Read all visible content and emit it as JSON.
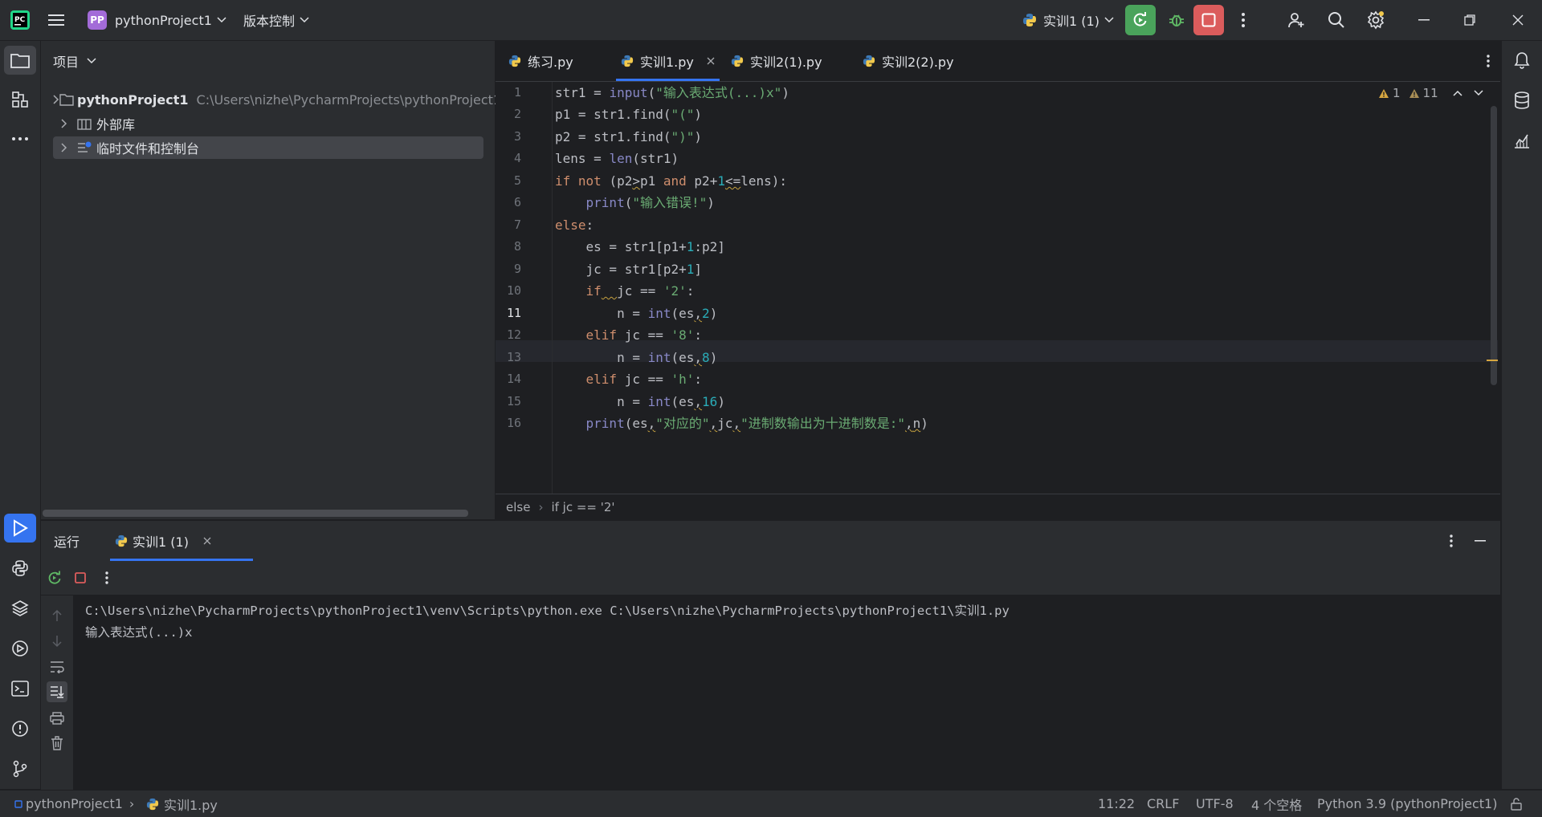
{
  "titlebar": {
    "project_badge": "PP",
    "project_name": "pythonProject1",
    "vcs_label": "版本控制",
    "run_config": "实训1 (1)"
  },
  "project_panel": {
    "title": "项目",
    "items": [
      {
        "label": "pythonProject1",
        "path": "C:\\Users\\nizhe\\PycharmProjects\\pythonProject1"
      },
      {
        "label": "外部库"
      },
      {
        "label": "临时文件和控制台"
      }
    ]
  },
  "editor": {
    "tabs": [
      {
        "label": "练习.py"
      },
      {
        "label": "实训1.py"
      },
      {
        "label": "实训2(1).py"
      },
      {
        "label": "实训2(2).py"
      }
    ],
    "warnings": {
      "weak": "1",
      "count": "11"
    },
    "line_numbers": [
      "1",
      "2",
      "3",
      "4",
      "5",
      "6",
      "7",
      "8",
      "9",
      "10",
      "11",
      "12",
      "13",
      "14",
      "15",
      "16"
    ],
    "breadcrumb": [
      "else",
      "if jc == '2'"
    ]
  },
  "run_panel": {
    "title": "运行",
    "tab_label": "实训1 (1)",
    "console": [
      "C:\\Users\\nizhe\\PycharmProjects\\pythonProject1\\venv\\Scripts\\python.exe C:\\Users\\nizhe\\PycharmProjects\\pythonProject1\\实训1.py",
      "输入表达式(...)x"
    ]
  },
  "statusbar": {
    "project": "pythonProject1",
    "file": "实训1.py",
    "position": "11:22",
    "line_sep": "CRLF",
    "encoding": "UTF-8",
    "indent": "4 个空格",
    "interpreter": "Python 3.9 (pythonProject1)"
  },
  "colors": {
    "accent": "#3574f0",
    "run_green": "#4aa35b",
    "stop_red": "#db5c5c",
    "bg": "#1e1f22",
    "panel": "#2b2d30"
  }
}
